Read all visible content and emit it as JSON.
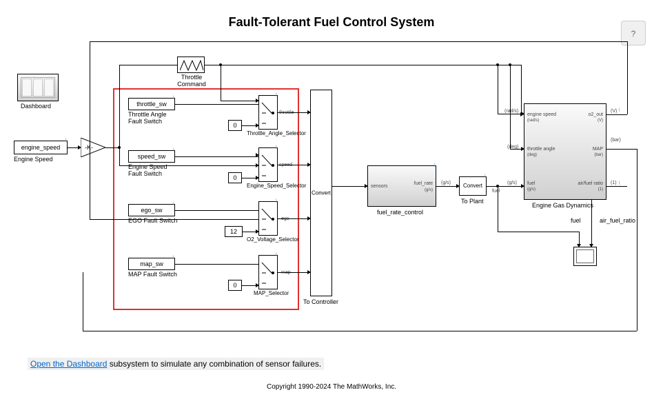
{
  "title": "Fault-Tolerant Fuel Control System",
  "help_label": "?",
  "dashboard_label": "Dashboard",
  "engine_speed_block": "engine_speed",
  "engine_speed_label": "Engine Speed",
  "gain_label": "-K-",
  "throttle_cmd_label": "Throttle\nCommand",
  "switches": {
    "throttle": {
      "text": "throttle_sw",
      "label": "Throttle Angle\nFault Switch",
      "const": "0",
      "selector": "Throttle_Angle_Selector",
      "port": "throttle"
    },
    "speed": {
      "text": "speed_sw",
      "label": "Engine Speed\nFault Switch",
      "const": "0",
      "selector": "Engine_Speed_Selector",
      "port": "speed"
    },
    "ego": {
      "text": "ego_sw",
      "label": "EGO Fault Switch",
      "const": "12",
      "selector": "O2_Voltage_Selector",
      "port": "ego"
    },
    "map": {
      "text": "map_sw",
      "label": "MAP Fault Switch",
      "const": "0",
      "selector": "MAP_Selector",
      "port": "map"
    }
  },
  "convert1_text": "Convert",
  "convert1_label": "To Controller",
  "fuel_rate": {
    "in": "sensors",
    "out": "fuel_rate",
    "out_unit": "(g/s)",
    "label": "fuel_rate_control"
  },
  "convert2_text": "Convert",
  "convert2_label": "To Plant",
  "sig_gs": "(g/s)",
  "sig_fuel": "fuel",
  "engine_dyn": {
    "label": "Engine Gas Dynamics",
    "in1": "engine speed",
    "in1_unit": "(rad/s)",
    "in2": "throttle angle",
    "in2_unit": "(deg)",
    "in3": "fuel",
    "in3_unit": "(g/s)",
    "out1": "o2_out",
    "out1_unit": "(V)",
    "out2": "MAP",
    "out2_unit": "(bar)",
    "out3": "air/fuel ratio",
    "out3_unit": "(1)"
  },
  "sig_rads": "(rad/s)",
  "sig_deg": "(deg)",
  "sig_V": "(V)",
  "sig_bar": "(bar)",
  "sig_1": "(1)",
  "out_fuel": "fuel",
  "out_afr": "air_fuel_ratio",
  "footer_link": "Open the Dashboard",
  "footer_text": " subsystem to simulate any combination of sensor failures.",
  "copyright": "Copyright 1990-2024  The MathWorks, Inc."
}
